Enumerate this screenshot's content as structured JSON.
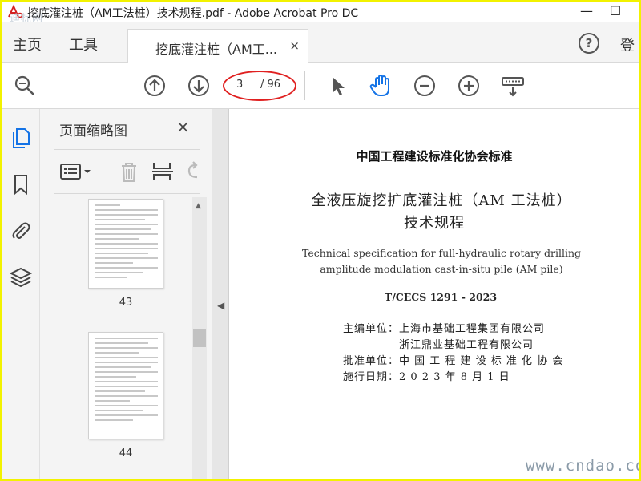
{
  "window": {
    "title": "挖底灌注桩（AM工法桩）技术规程.pdf - Adobe Acrobat Pro DC",
    "watermark_top": "迪标网",
    "minimize_icon": "—",
    "maximize_icon": "☐"
  },
  "menu": {
    "home": "主页",
    "tools": "工具",
    "doc_tab_label": "挖底灌注桩（AM工...",
    "doc_tab_close": "×",
    "help": "?",
    "signin_partial": "登"
  },
  "toolbar": {
    "current_page": "3",
    "total_pages": "/ 96",
    "icons": [
      "zoom-search-icon",
      "page-up-icon",
      "page-down-icon",
      "select-cursor-icon",
      "hand-icon",
      "zoom-out-icon",
      "zoom-in-icon",
      "keyboard-icon"
    ],
    "accent": "#1473e6",
    "highlight_color": "#e02020"
  },
  "left_rail": {
    "icons": [
      "pages-icon",
      "bookmark-icon",
      "attachment-icon",
      "layers-icon"
    ]
  },
  "thumbnail_panel": {
    "title": "页面缩略图",
    "close": "×",
    "pages": [
      {
        "number": "43"
      },
      {
        "number": "44"
      }
    ]
  },
  "document": {
    "org": "中国工程建设标准化协会标准",
    "title_line1": "全液压旋挖扩底灌注桩（AM 工法桩）",
    "title_line2": "技术规程",
    "english_line1": "Technical specification for full-hydraulic rotary drilling",
    "english_line2": "amplitude modulation cast-in-situ pile (AM pile)",
    "code": "T/CECS 1291 - 2023",
    "editor_label": "主编单位：",
    "editor_1": "上海市基础工程集团有限公司",
    "editor_2": "浙江鼎业基础工程有限公司",
    "approver_label": "批准单位：",
    "approver": "中 国 工 程 建 设 标 准 化 协 会",
    "effective_label": "施行日期：",
    "effective_date": "2 0 2 3   年   8   月   1   日"
  },
  "watermark_bottom": "www.cndao.com"
}
